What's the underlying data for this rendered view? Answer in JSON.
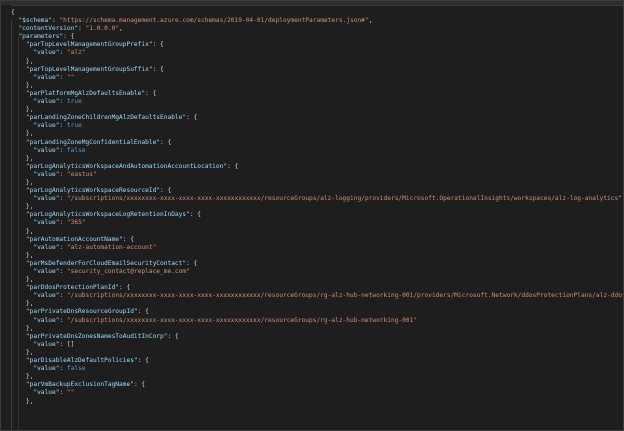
{
  "colors": {
    "background": "#1e1e1e",
    "key": "#9cdcfe",
    "string": "#ce9178",
    "literal": "#569cd6",
    "punctuation": "#d4d4d4"
  },
  "lines": [
    {
      "indent": 0,
      "tokens": [
        {
          "t": "{",
          "c": "brace"
        }
      ]
    },
    {
      "indent": 1,
      "tokens": [
        {
          "t": "\"$schema\"",
          "c": "key"
        },
        {
          "t": ": ",
          "c": "punct"
        },
        {
          "t": "\"https://schema.management.azure.com/schemas/2019-04-01/deploymentParameters.json#\"",
          "c": "str"
        },
        {
          "t": ",",
          "c": "punct"
        }
      ]
    },
    {
      "indent": 1,
      "tokens": [
        {
          "t": "\"contentVersion\"",
          "c": "key"
        },
        {
          "t": ": ",
          "c": "punct"
        },
        {
          "t": "\"1.0.0.0\"",
          "c": "str"
        },
        {
          "t": ",",
          "c": "punct"
        }
      ]
    },
    {
      "indent": 1,
      "tokens": [
        {
          "t": "\"parameters\"",
          "c": "key"
        },
        {
          "t": ": {",
          "c": "punct"
        }
      ]
    },
    {
      "indent": 2,
      "tokens": [
        {
          "t": "\"parTopLevelManagementGroupPrefix\"",
          "c": "key"
        },
        {
          "t": ": {",
          "c": "punct"
        }
      ]
    },
    {
      "indent": 3,
      "tokens": [
        {
          "t": "\"value\"",
          "c": "key"
        },
        {
          "t": ": ",
          "c": "punct"
        },
        {
          "t": "\"alz\"",
          "c": "str"
        }
      ]
    },
    {
      "indent": 2,
      "tokens": [
        {
          "t": "},",
          "c": "punct"
        }
      ]
    },
    {
      "indent": 2,
      "tokens": [
        {
          "t": "\"parTopLevelManagementGroupSuffix\"",
          "c": "key"
        },
        {
          "t": ": {",
          "c": "punct"
        }
      ]
    },
    {
      "indent": 3,
      "tokens": [
        {
          "t": "\"value\"",
          "c": "key"
        },
        {
          "t": ": ",
          "c": "punct"
        },
        {
          "t": "\"\"",
          "c": "str"
        }
      ]
    },
    {
      "indent": 2,
      "tokens": [
        {
          "t": "},",
          "c": "punct"
        }
      ]
    },
    {
      "indent": 2,
      "tokens": [
        {
          "t": "\"parPlatformMgAlzDefaultsEnable\"",
          "c": "key"
        },
        {
          "t": ": {",
          "c": "punct"
        }
      ]
    },
    {
      "indent": 3,
      "tokens": [
        {
          "t": "\"value\"",
          "c": "key"
        },
        {
          "t": ": ",
          "c": "punct"
        },
        {
          "t": "true",
          "c": "lit"
        }
      ]
    },
    {
      "indent": 2,
      "tokens": [
        {
          "t": "},",
          "c": "punct"
        }
      ]
    },
    {
      "indent": 2,
      "tokens": [
        {
          "t": "\"parLandingZoneChildrenMgAlzDefaultsEnable\"",
          "c": "key"
        },
        {
          "t": ": {",
          "c": "punct"
        }
      ]
    },
    {
      "indent": 3,
      "tokens": [
        {
          "t": "\"value\"",
          "c": "key"
        },
        {
          "t": ": ",
          "c": "punct"
        },
        {
          "t": "true",
          "c": "lit"
        }
      ]
    },
    {
      "indent": 2,
      "tokens": [
        {
          "t": "},",
          "c": "punct"
        }
      ]
    },
    {
      "indent": 2,
      "tokens": [
        {
          "t": "\"parLandingZoneMgConfidentialEnable\"",
          "c": "key"
        },
        {
          "t": ": {",
          "c": "punct"
        }
      ]
    },
    {
      "indent": 3,
      "tokens": [
        {
          "t": "\"value\"",
          "c": "key"
        },
        {
          "t": ": ",
          "c": "punct"
        },
        {
          "t": "false",
          "c": "lit"
        }
      ]
    },
    {
      "indent": 2,
      "tokens": [
        {
          "t": "},",
          "c": "punct"
        }
      ]
    },
    {
      "indent": 2,
      "tokens": [
        {
          "t": "\"parLogAnalyticsWorkspaceAndAutomationAccountLocation\"",
          "c": "key"
        },
        {
          "t": ": {",
          "c": "punct"
        }
      ]
    },
    {
      "indent": 3,
      "tokens": [
        {
          "t": "\"value\"",
          "c": "key"
        },
        {
          "t": ": ",
          "c": "punct"
        },
        {
          "t": "\"eastus\"",
          "c": "str"
        }
      ]
    },
    {
      "indent": 2,
      "tokens": [
        {
          "t": "},",
          "c": "punct"
        }
      ]
    },
    {
      "indent": 2,
      "tokens": [
        {
          "t": "\"parLogAnalyticsWorkspaceResourceId\"",
          "c": "key"
        },
        {
          "t": ": {",
          "c": "punct"
        }
      ]
    },
    {
      "indent": 3,
      "tokens": [
        {
          "t": "\"value\"",
          "c": "key"
        },
        {
          "t": ": ",
          "c": "punct"
        },
        {
          "t": "\"/subscriptions/xxxxxxxx-xxxx-xxxx-xxxx-xxxxxxxxxxxx/resourceGroups/alz-logging/providers/Microsoft.OperationalInsights/workspaces/alz-log-analytics\"",
          "c": "str"
        }
      ]
    },
    {
      "indent": 2,
      "tokens": [
        {
          "t": "},",
          "c": "punct"
        }
      ]
    },
    {
      "indent": 2,
      "tokens": [
        {
          "t": "\"parLogAnalyticsWorkspaceLogRetentionInDays\"",
          "c": "key"
        },
        {
          "t": ": {",
          "c": "punct"
        }
      ]
    },
    {
      "indent": 3,
      "tokens": [
        {
          "t": "\"value\"",
          "c": "key"
        },
        {
          "t": ": ",
          "c": "punct"
        },
        {
          "t": "\"365\"",
          "c": "str"
        }
      ]
    },
    {
      "indent": 2,
      "tokens": [
        {
          "t": "},",
          "c": "punct"
        }
      ]
    },
    {
      "indent": 2,
      "tokens": [
        {
          "t": "\"parAutomationAccountName\"",
          "c": "key"
        },
        {
          "t": ": {",
          "c": "punct"
        }
      ]
    },
    {
      "indent": 3,
      "tokens": [
        {
          "t": "\"value\"",
          "c": "key"
        },
        {
          "t": ": ",
          "c": "punct"
        },
        {
          "t": "\"alz-automation-account\"",
          "c": "str"
        }
      ]
    },
    {
      "indent": 2,
      "tokens": [
        {
          "t": "},",
          "c": "punct"
        }
      ]
    },
    {
      "indent": 2,
      "tokens": [
        {
          "t": "\"parMsDefenderForCloudEmailSecurityContact\"",
          "c": "key"
        },
        {
          "t": ": {",
          "c": "punct"
        }
      ]
    },
    {
      "indent": 3,
      "tokens": [
        {
          "t": "\"value\"",
          "c": "key"
        },
        {
          "t": ": ",
          "c": "punct"
        },
        {
          "t": "\"security_contact@replace_me.com\"",
          "c": "str"
        }
      ]
    },
    {
      "indent": 2,
      "tokens": [
        {
          "t": "},",
          "c": "punct"
        }
      ]
    },
    {
      "indent": 2,
      "tokens": [
        {
          "t": "\"parDdosProtectionPlanId\"",
          "c": "key"
        },
        {
          "t": ": {",
          "c": "punct"
        }
      ]
    },
    {
      "indent": 3,
      "tokens": [
        {
          "t": "\"value\"",
          "c": "key"
        },
        {
          "t": ": ",
          "c": "punct"
        },
        {
          "t": "\"/subscriptions/xxxxxxxx-xxxx-xxxx-xxxx-xxxxxxxxxxxx/resourceGroups/rg-alz-hub-networking-001/providers/Microsoft.Network/ddosProtectionPlans/alz-ddos-plan\"",
          "c": "str"
        }
      ]
    },
    {
      "indent": 2,
      "tokens": [
        {
          "t": "},",
          "c": "punct"
        }
      ]
    },
    {
      "indent": 2,
      "tokens": [
        {
          "t": "\"parPrivateDnsResourceGroupId\"",
          "c": "key"
        },
        {
          "t": ": {",
          "c": "punct"
        }
      ]
    },
    {
      "indent": 3,
      "tokens": [
        {
          "t": "\"value\"",
          "c": "key"
        },
        {
          "t": ": ",
          "c": "punct"
        },
        {
          "t": "\"/subscriptions/xxxxxxxx-xxxx-xxxx-xxxx-xxxxxxxxxxxx/resourceGroups/rg-alz-hub-networking-001\"",
          "c": "str"
        }
      ]
    },
    {
      "indent": 2,
      "tokens": [
        {
          "t": "},",
          "c": "punct"
        }
      ]
    },
    {
      "indent": 2,
      "tokens": [
        {
          "t": "\"parPrivateDnsZonesNamesToAuditInCorp\"",
          "c": "key"
        },
        {
          "t": ": {",
          "c": "punct"
        }
      ]
    },
    {
      "indent": 3,
      "tokens": [
        {
          "t": "\"value\"",
          "c": "key"
        },
        {
          "t": ": ",
          "c": "punct"
        },
        {
          "t": "[]",
          "c": "punct"
        }
      ]
    },
    {
      "indent": 2,
      "tokens": [
        {
          "t": "},",
          "c": "punct"
        }
      ]
    },
    {
      "indent": 2,
      "tokens": [
        {
          "t": "\"parDisableAlzDefaultPolicies\"",
          "c": "key"
        },
        {
          "t": ": {",
          "c": "punct"
        }
      ]
    },
    {
      "indent": 3,
      "tokens": [
        {
          "t": "\"value\"",
          "c": "key"
        },
        {
          "t": ": ",
          "c": "punct"
        },
        {
          "t": "false",
          "c": "lit"
        }
      ]
    },
    {
      "indent": 2,
      "tokens": [
        {
          "t": "},",
          "c": "punct"
        }
      ]
    },
    {
      "indent": 2,
      "tokens": [
        {
          "t": "\"parVmBackupExclusionTagName\"",
          "c": "key"
        },
        {
          "t": ": {",
          "c": "punct"
        }
      ]
    },
    {
      "indent": 3,
      "tokens": [
        {
          "t": "\"value\"",
          "c": "key"
        },
        {
          "t": ": ",
          "c": "punct"
        },
        {
          "t": "\"\"",
          "c": "str"
        }
      ]
    },
    {
      "indent": 2,
      "tokens": [
        {
          "t": "},",
          "c": "punct"
        }
      ]
    }
  ]
}
